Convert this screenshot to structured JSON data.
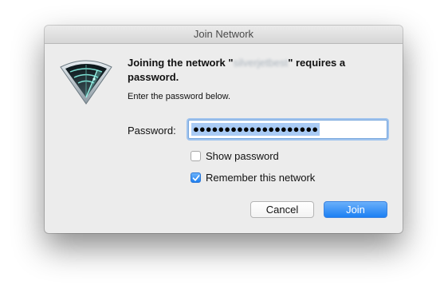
{
  "window": {
    "title": "Join Network"
  },
  "dialog": {
    "heading_prefix": "Joining the network \"",
    "network_name": "silverjetbest",
    "heading_suffix": "\" requires a password.",
    "instruction": "Enter the password below.",
    "password_label": "Password:",
    "password_value": "●●●●●●●●●●●●●●●●●●●●",
    "show_password_label": "Show password",
    "show_password_checked": false,
    "remember_label": "Remember this network",
    "remember_checked": true,
    "cancel_label": "Cancel",
    "join_label": "Join"
  },
  "icons": {
    "app_icon": "wifi-radar-icon",
    "checkmark": "checkmark-icon"
  },
  "colors": {
    "accent": "#1c7ff3",
    "selection": "#a9cbf5",
    "focus_ring": "#9fc3ee"
  }
}
